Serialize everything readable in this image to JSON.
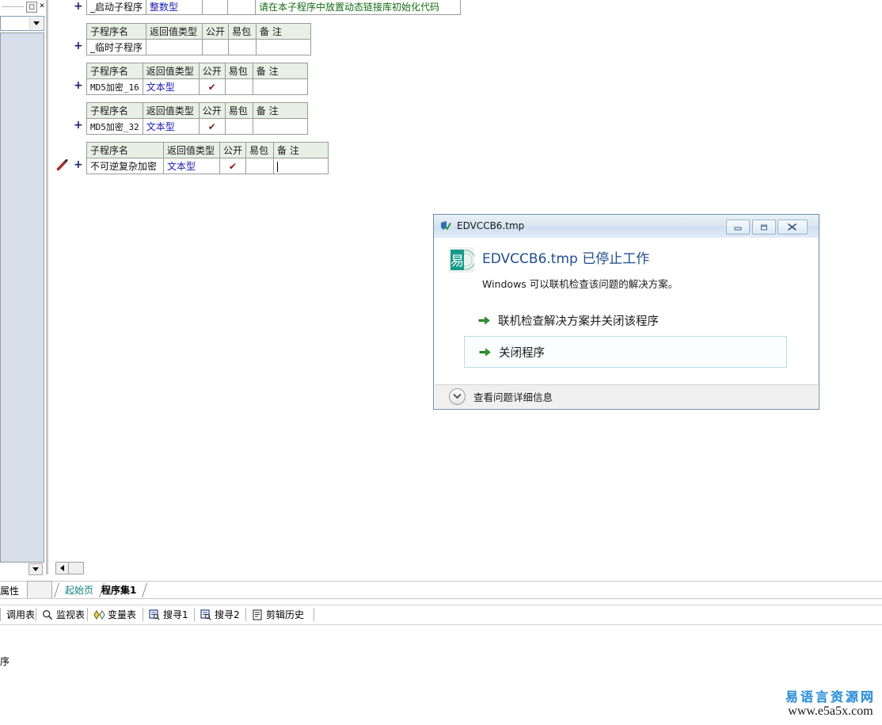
{
  "left_panel": {
    "maximize_icon": "maximize-icon",
    "close_icon": "close-icon",
    "combo_value": "",
    "dropdown_icon": "chevron-down-icon"
  },
  "editor": {
    "tables": [
      {
        "headers": [
          "子程序名",
          "返回值类型",
          "公开",
          "易包",
          "备 注"
        ],
        "show_header": false,
        "row": {
          "name": "_启动子程序",
          "return_type": "整数型",
          "public": "",
          "package": "",
          "note": "请在本子程序中放置动态链接库初始化代码"
        },
        "note_is_green": true,
        "expander": "+",
        "has_pencil": false
      },
      {
        "headers": [
          "子程序名",
          "返回值类型",
          "公开",
          "易包",
          "备 注"
        ],
        "show_header": true,
        "row": {
          "name": "_临时子程序",
          "return_type": "",
          "public": "",
          "package": "",
          "note": ""
        },
        "note_is_green": false,
        "expander": "+",
        "has_pencil": false
      },
      {
        "headers": [
          "子程序名",
          "返回值类型",
          "公开",
          "易包",
          "备 注"
        ],
        "show_header": true,
        "row": {
          "name": "MD5加密_16",
          "return_type": "文本型",
          "public": "✔",
          "package": "",
          "note": ""
        },
        "note_is_green": false,
        "expander": "+",
        "has_pencil": false
      },
      {
        "headers": [
          "子程序名",
          "返回值类型",
          "公开",
          "易包",
          "备 注"
        ],
        "show_header": true,
        "row": {
          "name": "MD5加密_32",
          "return_type": "文本型",
          "public": "✔",
          "package": "",
          "note": ""
        },
        "note_is_green": false,
        "expander": "+",
        "has_pencil": false
      },
      {
        "headers": [
          "子程序名",
          "返回值类型",
          "公开",
          "易包",
          "备 注"
        ],
        "show_header": true,
        "row": {
          "name": "不可逆复杂加密",
          "return_type": "文本型",
          "public": "✔",
          "package": "",
          "note": ""
        },
        "note_is_green": false,
        "note_has_caret": true,
        "expander": "+",
        "has_pencil": true
      }
    ],
    "hscroll_left_icon": "scroll-left-icon"
  },
  "tabstrip": {
    "property_label": "属性",
    "tabs": [
      {
        "label": "起始页",
        "active": false
      },
      {
        "label": "程序集1",
        "active": true
      }
    ]
  },
  "bottom_toolbar": {
    "items": [
      {
        "label": "调用表",
        "icon": ""
      },
      {
        "label": "监视表",
        "icon": "magnifier-icon"
      },
      {
        "label": "变量表",
        "icon": "diamonds-icon"
      },
      {
        "label": "搜寻1",
        "icon": "find-icon"
      },
      {
        "label": "搜寻2",
        "icon": "find-icon"
      },
      {
        "label": "剪辑历史",
        "icon": "clipboard-icon"
      }
    ]
  },
  "dialog": {
    "title": "EDVCCB6.tmp",
    "titlebar_icon": "app-shield-icon",
    "minimize_icon": "minimize-icon",
    "maximize_icon": "maximize-icon",
    "close_icon": "close-icon",
    "app_icon": "yi-language-icon",
    "heading": "EDVCCB6.tmp 已停止工作",
    "subtext": "Windows 可以联机检查该问题的解决方案。",
    "options": [
      {
        "label": "联机检查解决方案并关闭该程序",
        "highlighted": false,
        "icon": "green-arrow-icon"
      },
      {
        "label": "关闭程序",
        "highlighted": true,
        "icon": "green-arrow-icon"
      }
    ],
    "footer": {
      "label": "查看问题详细信息",
      "icon": "chevron-down-circle-icon"
    },
    "heading_color": "#1f4e8c"
  },
  "status": {
    "text": "序"
  },
  "watermark": {
    "line1": "易语言资源网",
    "line2": "www.e5a5x.com"
  }
}
